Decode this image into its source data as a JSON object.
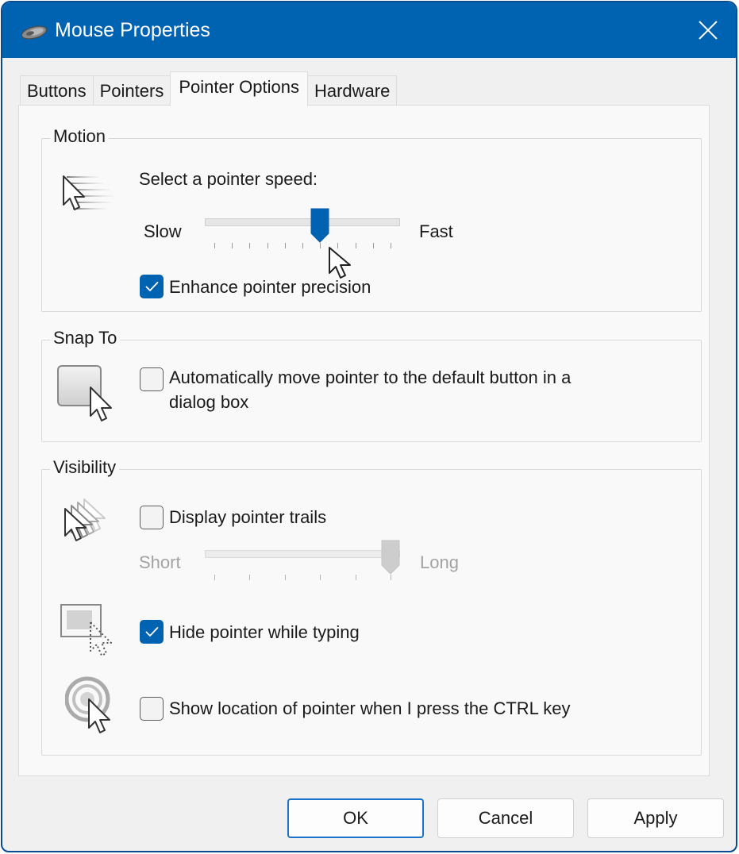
{
  "window": {
    "title": "Mouse Properties",
    "icon": "mouse-icon",
    "close_icon": "close-icon",
    "accent_color": "#0063b1"
  },
  "tabs": [
    {
      "label": "Buttons",
      "active": false
    },
    {
      "label": "Pointers",
      "active": false
    },
    {
      "label": "Pointer Options",
      "active": true
    },
    {
      "label": "Hardware",
      "active": false
    }
  ],
  "motion": {
    "group_label": "Motion",
    "icon": "pointer-speed-icon",
    "speed_label": "Select a pointer speed:",
    "slow_label": "Slow",
    "fast_label": "Fast",
    "speed_slider": {
      "min": 1,
      "max": 11,
      "value": 7,
      "ticks": 11,
      "enabled": true
    },
    "enhance_precision": {
      "label": "Enhance pointer precision",
      "checked": true
    }
  },
  "snap_to": {
    "group_label": "Snap To",
    "icon": "snap-to-icon",
    "auto_move": {
      "label_line1": "Automatically move pointer to the default button in a",
      "label_line2": "dialog box",
      "checked": false
    }
  },
  "visibility": {
    "group_label": "Visibility",
    "trails_icon": "pointer-trails-icon",
    "display_trails": {
      "label": "Display pointer trails",
      "checked": false
    },
    "short_label": "Short",
    "long_label": "Long",
    "trails_slider": {
      "min": 1,
      "max": 6,
      "value": 6,
      "ticks": 6,
      "enabled": false
    },
    "hide_icon": "hide-pointer-icon",
    "hide_while_typing": {
      "label": "Hide pointer while typing",
      "checked": true
    },
    "ctrl_icon": "show-location-icon",
    "show_location_ctrl": {
      "label": "Show location of pointer when I press the CTRL key",
      "checked": false
    }
  },
  "buttons": {
    "ok": "OK",
    "cancel": "Cancel",
    "apply": "Apply"
  }
}
